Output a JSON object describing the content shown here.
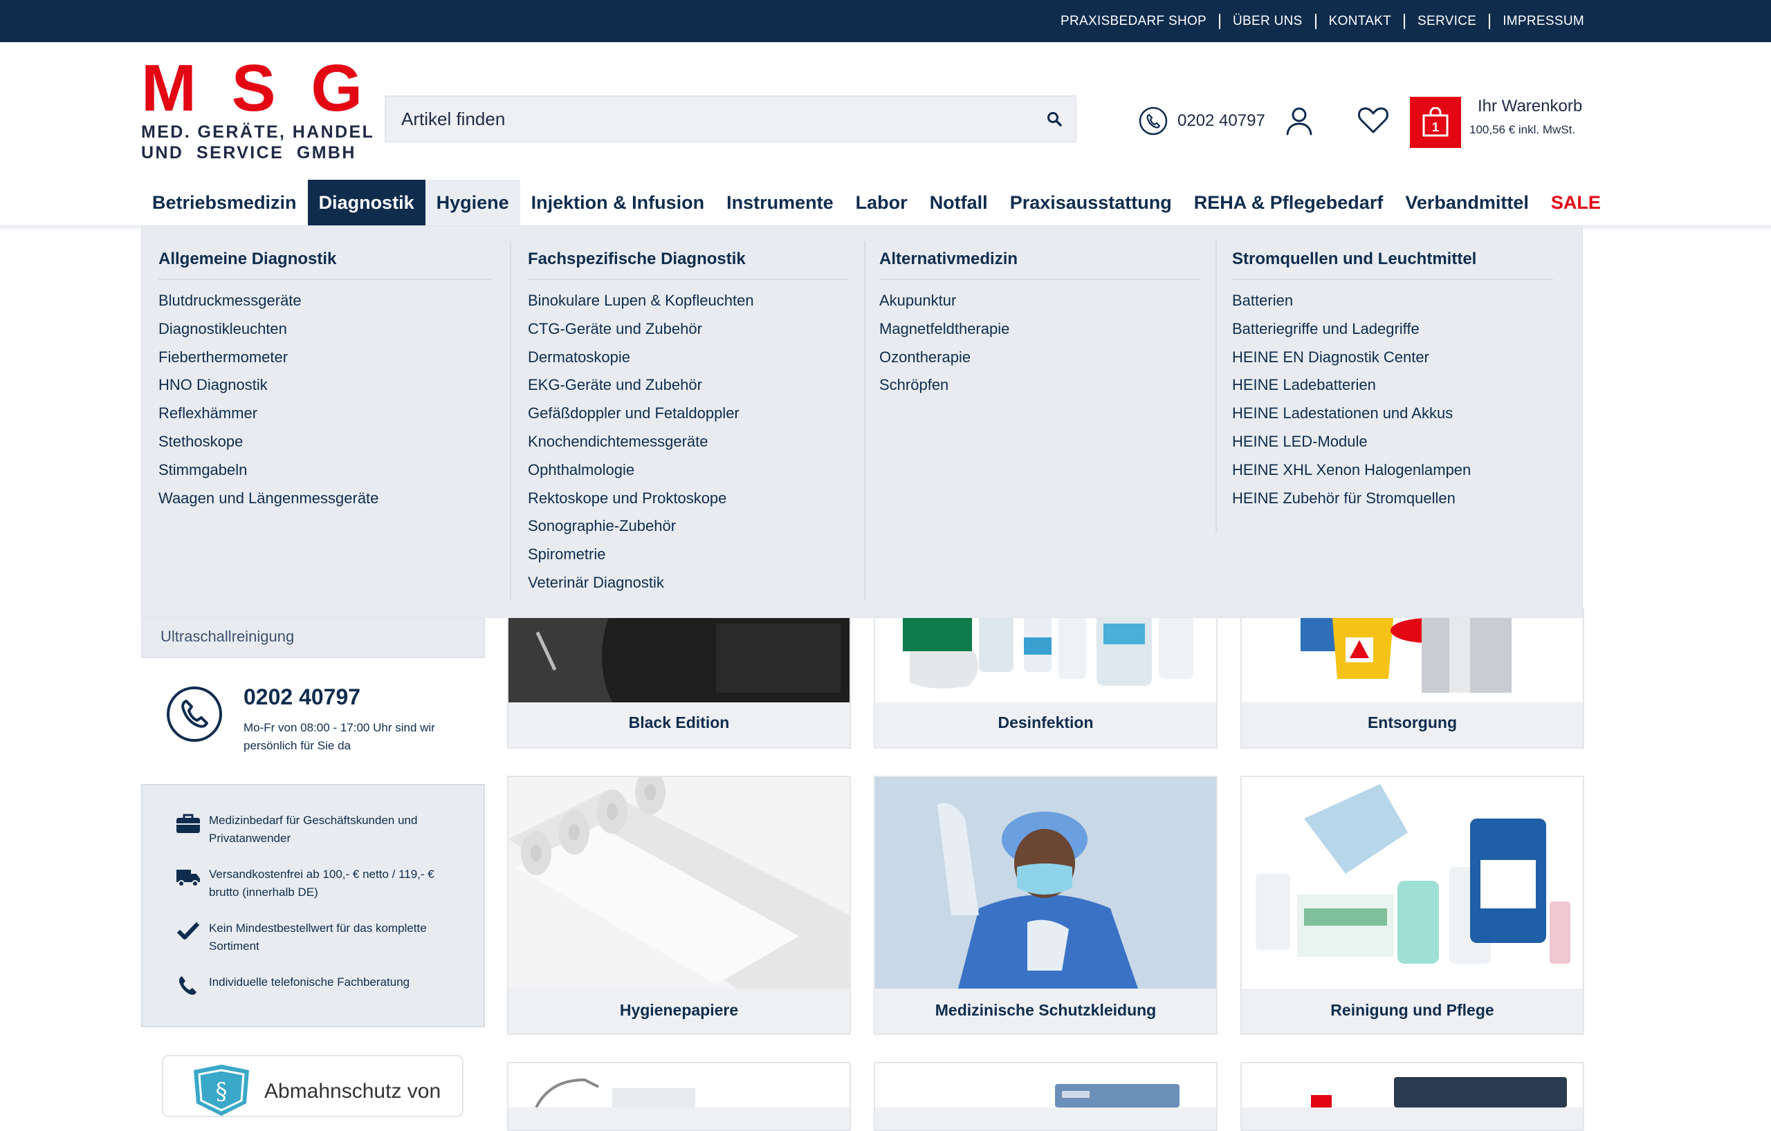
{
  "topnav": [
    "PRAXISBEDARF SHOP",
    "ÜBER UNS",
    "KONTAKT",
    "SERVICE",
    "IMPRESSUM"
  ],
  "logo": {
    "letters": [
      "M",
      "S",
      "G"
    ],
    "line1": "MED. GERÄTE, HANDEL",
    "line2": "UND  SERVICE  GMBH"
  },
  "search": {
    "placeholder": "Artikel finden"
  },
  "header": {
    "phone": "0202 40797",
    "cart_title": "Ihr Warenkorb",
    "cart_total": "100,56 € inkl. MwSt.",
    "cart_count": "1"
  },
  "nav": [
    "Betriebsmedizin",
    "Diagnostik",
    "Hygiene",
    "Injektion & Infusion",
    "Instrumente",
    "Labor",
    "Notfall",
    "Praxisausstattung",
    "REHA & Pflegebedarf",
    "Verbandmittel",
    "SALE"
  ],
  "mega": [
    {
      "title": "Allgemeine Diagnostik",
      "items": [
        "Blutdruckmessgeräte",
        "Diagnostikleuchten",
        "Fieberthermometer",
        "HNO Diagnostik",
        "Reflexhämmer",
        "Stethoskope",
        "Stimmgabeln",
        "Waagen und Längenmessgeräte"
      ]
    },
    {
      "title": "Fachspezifische Diagnostik",
      "items": [
        "Binokulare Lupen & Kopfleuchten",
        "CTG-Geräte und Zubehör",
        "Dermatoskopie",
        "EKG-Geräte und Zubehör",
        "Gefäßdoppler und Fetaldoppler",
        "Knochendichtemessgeräte",
        "Ophthalmologie",
        "Rektoskope und Proktoskope",
        "Sonographie-Zubehör",
        "Spirometrie",
        "Veterinär Diagnostik"
      ]
    },
    {
      "title": "Alternativmedizin",
      "items": [
        "Akupunktur",
        "Magnetfeldtherapie",
        "Ozontherapie",
        "Schröpfen"
      ]
    },
    {
      "title": "Stromquellen und Leuchtmittel",
      "items": [
        "Batterien",
        "Batteriegriffe und Ladegriffe",
        "HEINE EN Diagnostik Center",
        "HEINE Ladebatterien",
        "HEINE Ladestationen und Akkus",
        "HEINE LED-Module",
        "HEINE XHL Xenon Halogenlampen",
        "HEINE Zubehör für Stromquellen"
      ]
    }
  ],
  "sidebar": {
    "item": "Ultraschallreinigung",
    "contact_phone": "0202 40797",
    "contact_hours": "Mo-Fr von 08:00 - 17:00 Uhr sind wir persönlich für Sie da",
    "features": [
      {
        "icon": "briefcase-icon",
        "text": "Medizinbedarf für Geschäftskunden und Privatanwender"
      },
      {
        "icon": "truck-icon",
        "text": "Versandkostenfrei ab 100,- € netto / 119,- € brutto (innerhalb DE)"
      },
      {
        "icon": "check-icon",
        "text": "Kein Mindestbestellwert für das komplette Sortiment"
      },
      {
        "icon": "phone-icon",
        "text": "Individuelle telefonische Fachberatung"
      }
    ],
    "badge_text": "Abmahnschutz von"
  },
  "categories": [
    "Black Edition",
    "Desinfektion",
    "Entsorgung",
    "Hygienepapiere",
    "Medizinische Schutzkleidung",
    "Reinigung und Pflege"
  ],
  "colors": {
    "navy": "#0f2c4d",
    "red": "#e30613",
    "panel": "#e8ecf0"
  }
}
